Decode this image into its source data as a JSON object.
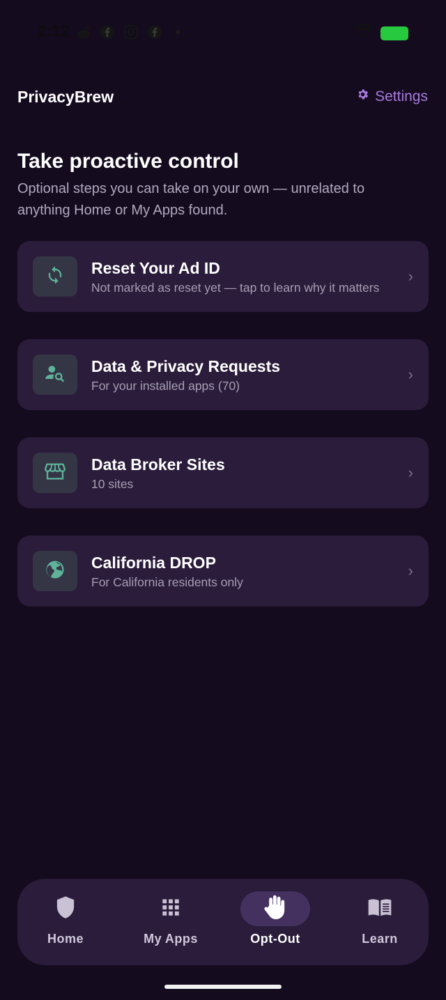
{
  "status_bar": {
    "time": "2:12"
  },
  "header": {
    "app_title": "PrivacyBrew",
    "settings_label": "Settings"
  },
  "hero": {
    "title": "Take proactive control",
    "subtitle": "Optional steps you can take on your own — unrelated to anything Home or My Apps found."
  },
  "cards": [
    {
      "icon": "refresh-icon",
      "title": "Reset Your Ad ID",
      "subtitle": "Not marked as reset yet — tap to learn why it matters"
    },
    {
      "icon": "person-search-icon",
      "title": "Data & Privacy Requests",
      "subtitle": "For your installed apps (70)"
    },
    {
      "icon": "storefront-icon",
      "title": "Data Broker Sites",
      "subtitle": "10 sites"
    },
    {
      "icon": "globe-icon",
      "title": "California DROP",
      "subtitle": "For California residents only"
    }
  ],
  "bottom_nav": {
    "active": "Opt-Out",
    "items": [
      {
        "icon": "shield-icon",
        "label": "Home"
      },
      {
        "icon": "grid-icon",
        "label": "My Apps"
      },
      {
        "icon": "hand-icon",
        "label": "Opt-Out"
      },
      {
        "icon": "book-icon",
        "label": "Learn"
      }
    ]
  },
  "colors": {
    "background": "#140b1f",
    "card": "#2a1c3a",
    "accent": "#a77bdc",
    "icon_green": "#5fb39a"
  }
}
